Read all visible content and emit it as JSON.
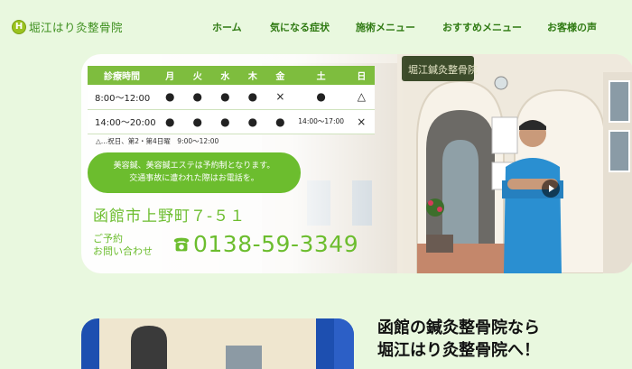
{
  "brand": {
    "logo_letter": "H",
    "name": "堀江はり灸整骨院"
  },
  "nav": {
    "items": [
      {
        "label": "ホーム"
      },
      {
        "label": "気になる症状"
      },
      {
        "label": "施術メニュー"
      },
      {
        "label": "おすすめメニュー"
      },
      {
        "label": "お客様の声"
      }
    ]
  },
  "schedule": {
    "headers": [
      "診療時間",
      "月",
      "火",
      "水",
      "木",
      "金",
      "土",
      "日"
    ],
    "rows": [
      {
        "time": "8:00～12:00",
        "cells": [
          "●",
          "●",
          "●",
          "●",
          "×",
          "●",
          "△"
        ]
      },
      {
        "time": "14:00～20:00",
        "cells": [
          "●",
          "●",
          "●",
          "●",
          "●",
          "14:00～17:00",
          "×"
        ]
      }
    ],
    "note": "△…祝日、第2・第4日曜　9:00～12:00"
  },
  "notice": {
    "line1": "美容鍼、美容鍼エステは予約制となります。",
    "line2": "交通事故に遭われた際はお電話を。"
  },
  "contact": {
    "address": "函館市上野町７-５１",
    "label1": "ご予約",
    "label2": "お問い合わせ",
    "phone": "0138-59-3349"
  },
  "hero_sign": "堀江鍼灸整骨院",
  "section": {
    "headline1": "函館の鍼灸整骨院なら",
    "headline2": "堀江はり灸整骨院へ！"
  },
  "colors": {
    "brand_green": "#6cbd2e",
    "nav_green": "#2f7a12",
    "page_bg": "#e9f8df"
  }
}
